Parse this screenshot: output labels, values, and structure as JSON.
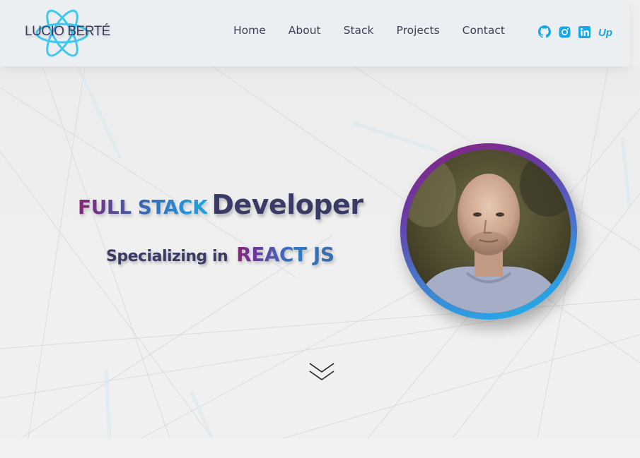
{
  "header": {
    "logo_text": "LUCIO BERTÉ",
    "logo_icon": "react-atom-icon",
    "nav": [
      {
        "label": "Home"
      },
      {
        "label": "About"
      },
      {
        "label": "Stack"
      },
      {
        "label": "Projects"
      },
      {
        "label": "Contact"
      }
    ],
    "social": [
      {
        "icon": "github-icon"
      },
      {
        "icon": "instagram-icon"
      },
      {
        "icon": "linkedin-icon"
      },
      {
        "icon": "upwork-icon",
        "text": "Up"
      }
    ],
    "social_color": "#15a7e8"
  },
  "hero": {
    "headline_gradient": "FULL STACK",
    "headline_main": "Developer",
    "subline_prefix": "Specializing in",
    "subline_highlight": "REACT JS",
    "portrait_icon": "profile-photo",
    "scroll_icon": "double-chevron-down-icon"
  },
  "colors": {
    "text_dark": "#3a3a66",
    "gradient_start": "#8a237a",
    "gradient_end": "#1aa6e0"
  }
}
